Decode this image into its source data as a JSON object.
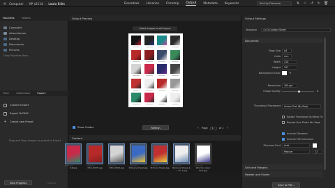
{
  "topbar": {
    "breadcrumb": [
      "Computer",
      "HP x2114",
      "Lowia Edits"
    ],
    "modes": [
      "Essentials",
      "Libraries",
      "Filmstrip",
      "Output",
      "Metadata",
      "Keywords"
    ],
    "active_mode": "Output",
    "sort_label": "Sort by Filename"
  },
  "left_panel": {
    "tabs": [
      "Favorites",
      "Folders"
    ],
    "favorites": [
      "Computer",
      "allisonliaman",
      "Desktop",
      "Documents",
      "Pictures"
    ],
    "drag_hint": "Drag Favorites Here...",
    "lower_tabs": [
      "Filter",
      "Collections",
      "Export"
    ],
    "export_items": [
      "Custom Export",
      "Export To DNG"
    ],
    "create_preset": "Create new Preset",
    "drop_hint": "Drag and Drop images on preset to Export",
    "view_progress": "View Progress",
    "cancel_label": "Cancel"
  },
  "center": {
    "panel_title": "Output Preview",
    "header_label": "Select Images to edit layout",
    "show_guides": "Show Guides",
    "refresh_label": "Refresh",
    "page_label": "Page",
    "page_num": "1",
    "of_label": "of 1",
    "content_title": "Content"
  },
  "thumbnails": [
    {
      "name": "0.6.jpg",
      "colors": [
        "#c92a4a",
        "#2c8a6a"
      ]
    },
    {
      "name": "DSC_0005.jpg",
      "colors": [
        "#b82a2a",
        "#8a1d1d"
      ]
    },
    {
      "name": "DSC_0006.jpg",
      "colors": [
        "#d4d4d4",
        "#5a5a5a"
      ]
    },
    {
      "name": "Primary Sheet.jpg",
      "colors": [
        "#3a6ac4",
        "#f0c030"
      ]
    },
    {
      "name": "Primary Sheet.jpg",
      "colors": [
        "#c03030",
        "#e8d040"
      ]
    },
    {
      "name": "Remove Shape & ... for 1.jpg",
      "colors": [
        "#eeeeee",
        "#6a8ab0"
      ]
    },
    {
      "name": "Word as clear text.jpg",
      "colors": [
        "#ffffff",
        "#3a3a8a"
      ]
    }
  ],
  "right_panel": {
    "title": "Output Settings",
    "template_label": "Template",
    "template_value": "4 x 5 Contact Sheet",
    "document_section": "Document",
    "rows": [
      {
        "label": "Page Size",
        "value": "A4"
      },
      {
        "label": "Units",
        "value": "mm"
      },
      {
        "label": "Width",
        "value": "210"
      },
      {
        "label": "Height",
        "value": "297"
      },
      {
        "label": "Background Color",
        "value": ""
      },
      {
        "label": "Resolution",
        "value": "300 ppi"
      },
      {
        "label": "Image Quality",
        "value": "6"
      }
    ],
    "placement_label": "Thumbnail Placement",
    "placement_value": "Across First (By Row)",
    "checks": [
      {
        "label": "Rotate Thumbnail for Best Fit",
        "checked": false
      },
      {
        "label": "Repeat One Photo Per Page",
        "checked": false
      },
      {
        "label": "Include Filename",
        "checked": true
      },
      {
        "label": "Include File Extension",
        "checked": true
      }
    ],
    "filename_font_label": "Filename Font",
    "font_value": "Arial",
    "font_style": "Regular",
    "font_size": "12",
    "grid_section": "Grid and Margins",
    "header_section": "Header and Footer",
    "save_button": "Save to PDF..."
  },
  "colors": {
    "accent": "#4a90e2",
    "panel_bg": "#282828",
    "preview_bg": "#1c1c1c"
  }
}
